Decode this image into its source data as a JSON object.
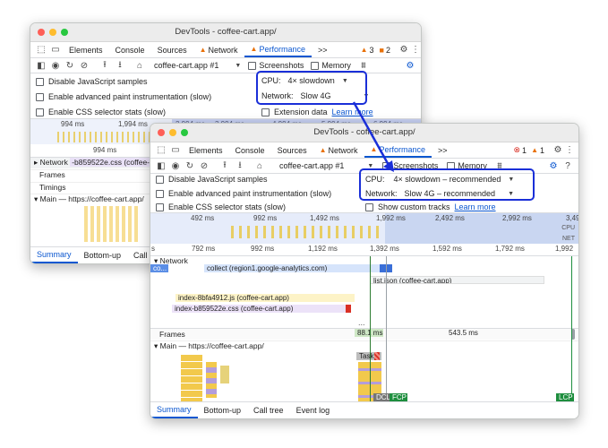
{
  "back_window": {
    "title": "DevTools - coffee-cart.app/",
    "tabs": [
      "Elements",
      "Console",
      "Sources",
      "Network",
      "Performance"
    ],
    "more_tabs": ">>",
    "warn_count": "3",
    "issue_count": "2",
    "recording_select": "coffee-cart.app #1",
    "screenshots_label": "Screenshots",
    "memory_label": "Memory",
    "disable_js_label": "Disable JavaScript samples",
    "paint_label": "Enable advanced paint instrumentation (slow)",
    "css_label": "Enable CSS selector stats (slow)",
    "cpu_label": "CPU:",
    "cpu_value": "4× slowdown",
    "network_label": "Network:",
    "network_value": "Slow 4G",
    "extension_label": "Extension data",
    "learn_more": "Learn more",
    "ruler_ticks": [
      "994 ms",
      "1,994 ms",
      "2,994 ms",
      "3,994 ms",
      "4,994 ms",
      "5,994 ms",
      "6,994 ms"
    ],
    "ruler_ms": "994 ms",
    "network_row": "Network",
    "network_item": "-b859522e.css (coffee-...",
    "frames_label": "Frames",
    "timings_label": "Timings",
    "main_label": "Main — https://coffee-cart.app/",
    "bottom_tabs": [
      "Summary",
      "Bottom-up",
      "Call tre"
    ]
  },
  "front_window": {
    "title": "DevTools - coffee-cart.app/",
    "tabs": [
      "Elements",
      "Console",
      "Sources",
      "Network",
      "Performance"
    ],
    "more_tabs": ">>",
    "error_count": "1",
    "warn_count": "1",
    "recording_select": "coffee-cart.app #1",
    "screenshots_label": "Screenshots",
    "memory_label": "Memory",
    "disable_js_label": "Disable JavaScript samples",
    "paint_label": "Enable advanced paint instrumentation (slow)",
    "css_label": "Enable CSS selector stats (slow)",
    "cpu_label": "CPU:",
    "cpu_value": "4× slowdown – recommended",
    "network_label": "Network:",
    "network_value": "Slow 4G – recommended",
    "custom_tracks_label": "Show custom tracks",
    "learn_more": "Learn more",
    "overview_ticks": [
      "492 ms",
      "992 ms",
      "1,492 ms",
      "1,992 ms",
      "2,492 ms",
      "2,992 ms",
      "3,49"
    ],
    "overview_cpu": "CPU",
    "overview_net": "NET",
    "ruler_start": "s",
    "ruler_ticks": [
      "792 ms",
      "992 ms",
      "1,192 ms",
      "1,392 ms",
      "1,592 ms",
      "1,792 ms",
      "1,992"
    ],
    "network_row": "Network",
    "net_short": "co...",
    "req_collect": "collect (region1.google-analytics.com)",
    "req_list": "list.json (coffee-cart.app)",
    "req_index_js": "index-8bfa4912.js (coffee-cart.app)",
    "req_index_css": "index-b859522e.css (coffee-cart.app)",
    "more_dots": "...",
    "frames_label": "Frames",
    "frame_a": "88.1 ms",
    "frame_b": "543.5 ms",
    "main_label": "Main — https://coffee-cart.app/",
    "task_label": "Task",
    "dcl_label": "DCL",
    "fcp_label": "FCP",
    "lcp_label": "LCP",
    "bottom_tabs": [
      "Summary",
      "Bottom-up",
      "Call tree",
      "Event log"
    ]
  },
  "colors": {
    "accent": "#0b57d0",
    "highlight": "#1a2fd8",
    "warning": "#e8710a",
    "error": "#d93025",
    "scripting": "#f2c94c",
    "rendering": "#b39ddb",
    "lcp_green": "#1e8e3e"
  }
}
